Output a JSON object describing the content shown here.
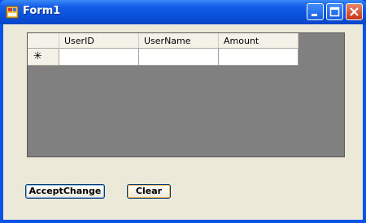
{
  "window": {
    "title": "Form1"
  },
  "grid": {
    "columns": [
      "UserID",
      "UserName",
      "Amount"
    ],
    "new_row_marker": "✳"
  },
  "buttons": {
    "accept_label": "AcceptChange",
    "clear_label": "Clear"
  },
  "colors": {
    "titlebar": "#0a52dc",
    "client": "#ece9d8",
    "grid_background": "#808080"
  },
  "icons": [
    "app-icon",
    "minimize-icon",
    "maximize-icon",
    "close-icon"
  ]
}
